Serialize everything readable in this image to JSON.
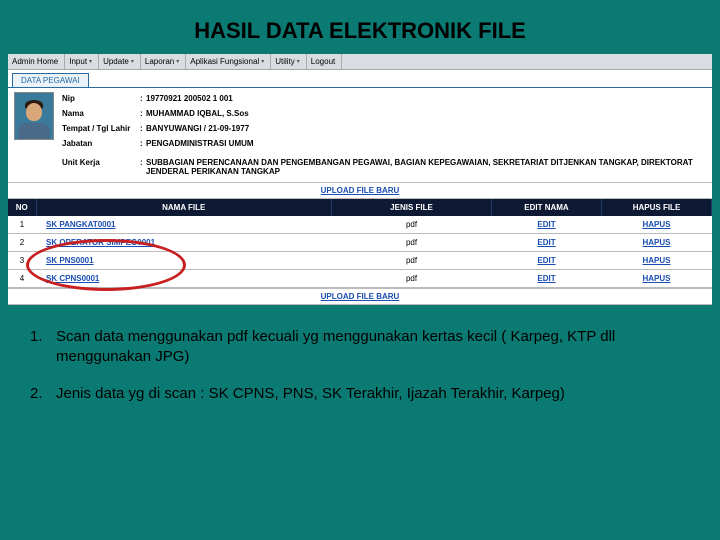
{
  "slide": {
    "title": "HASIL DATA ELEKTRONIK FILE"
  },
  "menu": {
    "items": [
      "Admin Home",
      "Input",
      "Update",
      "Laporan",
      "Aplikasi Fungsional",
      "Utility",
      "Logout"
    ]
  },
  "tab": {
    "label": "DATA PEGAWAI"
  },
  "employee": {
    "fields": {
      "nip_label": "Nip",
      "nip_value": "19770921 200502 1 001",
      "nama_label": "Nama",
      "nama_value": "MUHAMMAD IQBAL, S.Sos",
      "ttl_label": "Tempat / Tgl Lahir",
      "ttl_value": "BANYUWANGI / 21-09-1977",
      "jabatan_label": "Jabatan",
      "jabatan_value": "PENGADMINISTRASI UMUM",
      "unit_label": "Unit Kerja",
      "unit_value": "SUBBAGIAN PERENCANAAN DAN PENGEMBANGAN PEGAWAI, BAGIAN KEPEGAWAIAN, SEKRETARIAT DITJENKAN TANGKAP, DIREKTORAT JENDERAL PERIKANAN TANGKAP"
    }
  },
  "upload": {
    "label": "UPLOAD FILE BARU"
  },
  "table": {
    "headers": {
      "no": "NO",
      "nama": "NAMA FILE",
      "jenis": "JENIS FILE",
      "edit": "EDIT NAMA",
      "hapus": "HAPUS FILE"
    },
    "rows": [
      {
        "no": "1",
        "nama": "SK PANGKAT0001",
        "jenis": "pdf",
        "edit": "EDIT",
        "hapus": "HAPUS"
      },
      {
        "no": "2",
        "nama": "SK OPERATOR SIMPEG0001",
        "jenis": "pdf",
        "edit": "EDIT",
        "hapus": "HAPUS"
      },
      {
        "no": "3",
        "nama": "SK PNS0001",
        "jenis": "pdf",
        "edit": "EDIT",
        "hapus": "HAPUS"
      },
      {
        "no": "4",
        "nama": "SK CPNS0001",
        "jenis": "pdf",
        "edit": "EDIT",
        "hapus": "HAPUS"
      }
    ]
  },
  "notes": {
    "items": [
      {
        "num": "1.",
        "text": "Scan data menggunakan pdf kecuali yg menggunakan kertas kecil ( Karpeg, KTP dll menggunakan JPG)"
      },
      {
        "num": "2.",
        "text": "Jenis data yg di scan : SK CPNS, PNS, SK Terakhir, Ijazah Terakhir, Karpeg)"
      }
    ]
  },
  "annotation": {
    "circle_color": "#c82020"
  }
}
